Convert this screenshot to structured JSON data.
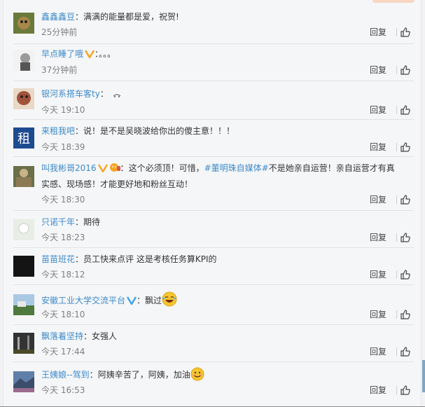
{
  "ui": {
    "reply_label": "回复"
  },
  "comments": [
    {
      "user": "鑫鑫鑫豆",
      "sep": "：",
      "text": "满满的能量都是爱，祝贺!",
      "time": "25分钟前"
    },
    {
      "user": "早点睡了哦",
      "sep": "：",
      "text": "。。。",
      "time": "37分钟前"
    },
    {
      "user": "银河系搭车客ty",
      "sep": "：",
      "text": "",
      "time": "今天 19:10"
    },
    {
      "user": "来租我吧",
      "sep": "：",
      "text": "说！是不是吴晓波给你出的傻主意！！！",
      "time": "今天 18:39"
    },
    {
      "user": "叫我彬哥2016",
      "sep": "：",
      "text_a": "这个必须顶！可惜，",
      "tag": "#董明珠自媒体#",
      "text_b": "不是她亲自运营！亲自运营才有真实感、现场感！才能更好地和粉丝互动！",
      "time": "今天 18:30"
    },
    {
      "user": "只诺千年",
      "sep": "：",
      "text": "期待",
      "time": "今天 18:23"
    },
    {
      "user": "苗苗班花",
      "sep": "：",
      "text": "员工快来点评 这是考核任务算KPI的",
      "time": "今天 18:12"
    },
    {
      "user": "安徽工业大学交流平台",
      "sep": "：",
      "text": "飘过",
      "time": "今天 18:10"
    },
    {
      "user": "飘落着坚持",
      "sep": "：",
      "text": "女强人",
      "time": "今天 17:44"
    },
    {
      "user": "王姨娘--驾到",
      "sep": "：",
      "text": "阿姨辛苦了，阿姨，加油",
      "time": "今天 16:53"
    }
  ]
}
